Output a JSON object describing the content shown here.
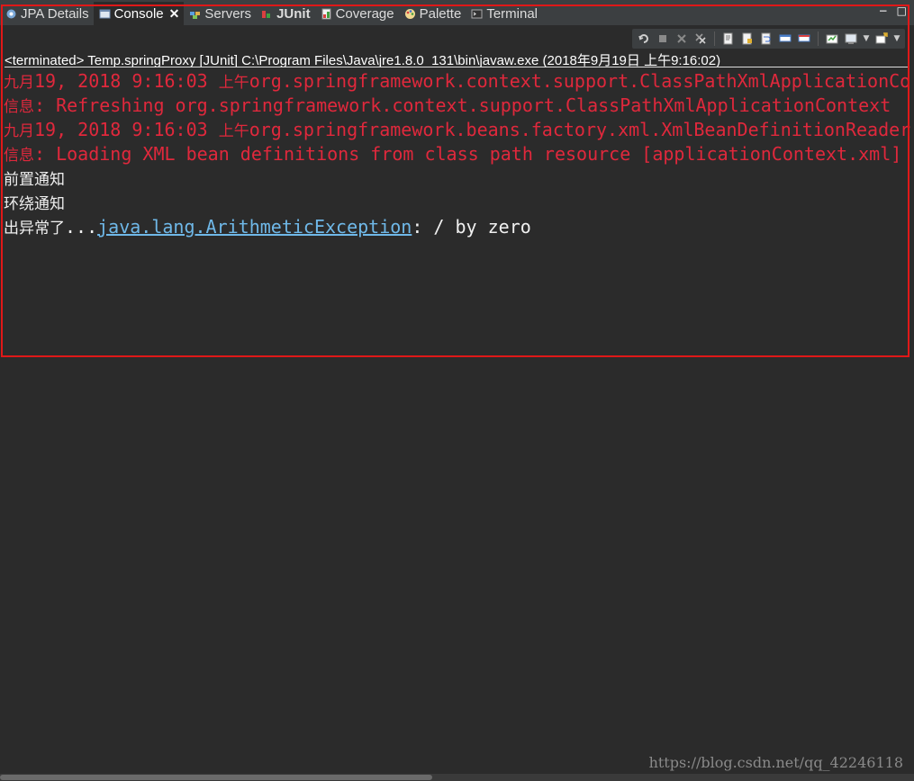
{
  "tabs": [
    {
      "label": "JPA Details",
      "icon": "jpa-details-icon"
    },
    {
      "label": "Console",
      "icon": "console-icon",
      "active": true,
      "close": "✕"
    },
    {
      "label": "Servers",
      "icon": "servers-icon"
    },
    {
      "label": "JUnit",
      "icon": "junit-icon",
      "prefix": "J"
    },
    {
      "label": "Coverage",
      "icon": "coverage-icon"
    },
    {
      "label": "Palette",
      "icon": "palette-icon"
    },
    {
      "label": "Terminal",
      "icon": "terminal-icon"
    }
  ],
  "window_controls": {
    "minimize": "−",
    "maximize": "□"
  },
  "toolbar": {
    "icons": [
      "relaunch-icon",
      "terminate-icon",
      "remove-launch-icon",
      "remove-all-terminated-icon",
      "clear-console-icon",
      "scroll-lock-icon",
      "word-wrap-icon",
      "show-stdout-icon",
      "show-stderr-icon",
      "pin-console-icon",
      "display-console-icon",
      "open-console-icon"
    ]
  },
  "status": {
    "text": "<terminated> Temp.springProxy [JUnit] C:\\Program Files\\Java\\jre1.8.0_131\\bin\\javaw.exe (2018年9月19日 上午9:16:02)"
  },
  "console": {
    "lines": [
      {
        "type": "red",
        "cjk_pre": "九月",
        "text_a": "19, 2018 9:16:03 ",
        "cjk_mid": "上午",
        "text_b": "org.springframework.context.support.ClassPathXmlApplicationContext prepareRefresh"
      },
      {
        "type": "red",
        "cjk_pre": "信息",
        "text_a": ": Refreshing org.springframework.context.support.ClassPathXmlApplicationContext",
        "cjk_mid": "",
        "text_b": ""
      },
      {
        "type": "red",
        "cjk_pre": "九月",
        "text_a": "19, 2018 9:16:03 ",
        "cjk_mid": "上午",
        "text_b": "org.springframework.beans.factory.xml.XmlBeanDefinitionReader loadBeanDefinitions"
      },
      {
        "type": "red",
        "cjk_pre": "信息",
        "text_a": ": Loading XML bean definitions from class path resource [applicationContext.xml]",
        "cjk_mid": "",
        "text_b": ""
      }
    ],
    "plain_lines": [
      "前置通知",
      "环绕通知"
    ],
    "exception_line": {
      "prefix": "出异常了",
      "dots": "...",
      "link": "java.lang.ArithmeticException",
      "suffix": ": / by zero"
    }
  },
  "colors": {
    "error_text": "#e0283c",
    "link": "#6fb8e8",
    "highlight_border": "#e01818",
    "background": "#2b2b2b"
  },
  "watermark": "https://blog.csdn.net/qq_42246118"
}
